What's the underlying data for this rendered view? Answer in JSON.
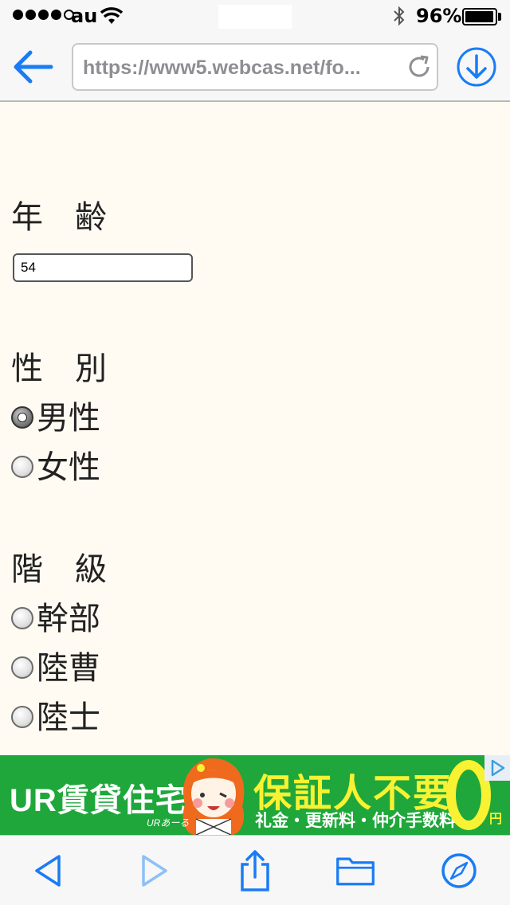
{
  "status_bar": {
    "signal_dots": 5,
    "signal_filled": 4,
    "carrier": "au",
    "battery_text": "96%",
    "battery_level": 0.96
  },
  "nav": {
    "url": "https://www5.webcas.net/fo...",
    "accent_color": "#1a7cf5"
  },
  "form": {
    "age": {
      "label_chars": [
        "年",
        "齢"
      ],
      "value": "54"
    },
    "gender": {
      "label_chars": [
        "性",
        "別"
      ],
      "options": [
        {
          "label": "男性",
          "checked": true
        },
        {
          "label": "女性",
          "checked": false
        }
      ]
    },
    "rank": {
      "label_chars": [
        "階",
        "級"
      ],
      "options": [
        {
          "label": "幹部",
          "checked": false
        },
        {
          "label": "陸曹",
          "checked": false
        },
        {
          "label": "陸士",
          "checked": false
        }
      ]
    }
  },
  "ad": {
    "brand": "UR賃貸住宅",
    "small_brand": "URあーる",
    "headline": "保証人不要",
    "subline": "礼金・更新料・仲介手数料",
    "zero_unit": "円",
    "colors": {
      "background": "#1fa73b",
      "headline": "#f8f232"
    }
  },
  "toolbar": {
    "icons": [
      "back-icon",
      "forward-icon",
      "share-icon",
      "bookmarks-icon",
      "safari-icon"
    ]
  }
}
